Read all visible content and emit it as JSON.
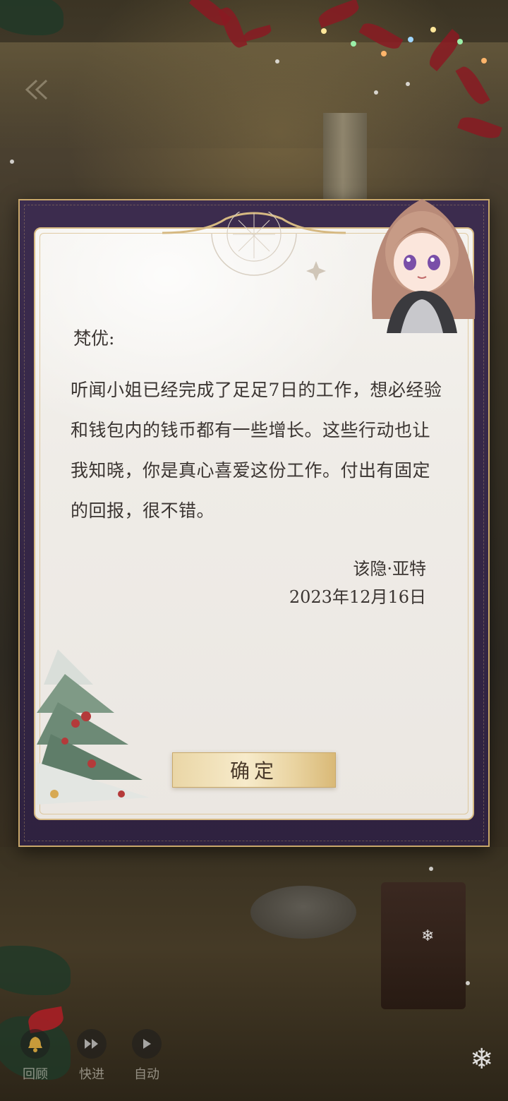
{
  "letter": {
    "greeting": "梵优:",
    "body": "听闻小姐已经完成了足足7日的工作，想必经验和钱包内的钱币都有一些增长。这些行动也让我知晓，你是真心喜爱这份工作。付出有固定的回报，很不错。",
    "signer": "该隐·亚特",
    "date": "2023年12月16日",
    "confirm_label": "确定"
  },
  "controls": {
    "review_label": "回顾",
    "fast_forward_label": "快进",
    "auto_label": "自动"
  },
  "icons": {
    "back": "back-arrow-icon",
    "review": "bell-icon",
    "fast_forward": "fast-forward-icon",
    "auto": "play-icon",
    "snow": "snowflake-icon"
  },
  "colors": {
    "frame": "#3c2c4e",
    "gold": "#c9a86b",
    "paper": "#f4f2ee",
    "text": "#3b3532"
  }
}
